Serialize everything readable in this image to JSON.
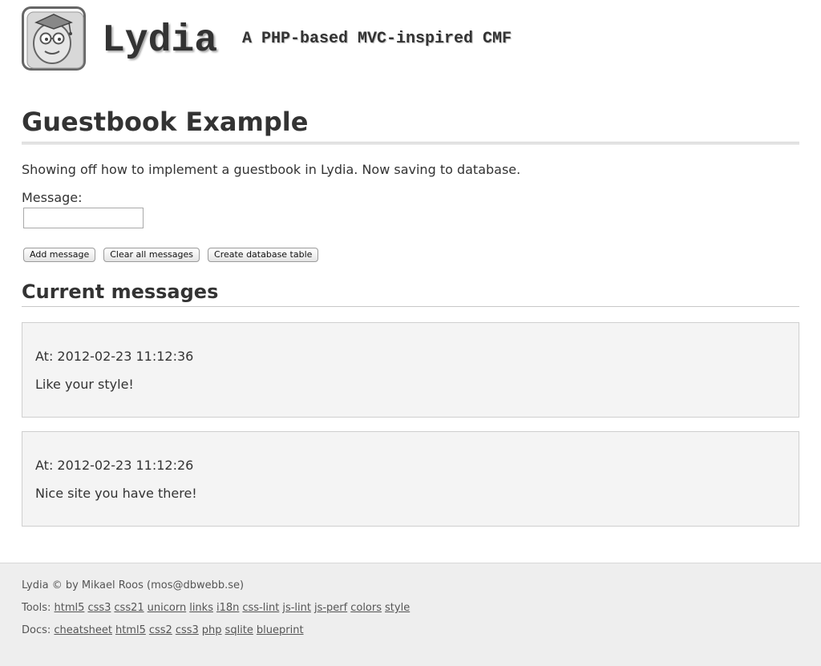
{
  "header": {
    "logo_icon": "lydia-logo-icon",
    "site_title": "Lydia",
    "site_slogan": "A PHP-based MVC-inspired CMF"
  },
  "main": {
    "page_title": "Guestbook Example",
    "intro": "Showing off how to implement a guestbook in Lydia. Now saving to database.",
    "form": {
      "message_label": "Message:",
      "message_value": "",
      "buttons": [
        {
          "label": "Add message"
        },
        {
          "label": "Clear all messages"
        },
        {
          "label": "Create database table"
        }
      ]
    },
    "messages_title": "Current messages",
    "messages": [
      {
        "time": "At: 2012-02-23 11:12:36",
        "text": "Like your style!"
      },
      {
        "time": "At: 2012-02-23 11:12:26",
        "text": "Nice site you have there!"
      }
    ]
  },
  "footer": {
    "copyright": "Lydia © by Mikael Roos (mos@dbwebb.se)",
    "tools_label": "Tools:",
    "tools_links": [
      "html5",
      "css3",
      "css21",
      "unicorn",
      "links",
      "i18n",
      "css-lint",
      "js-lint",
      "js-perf",
      "colors",
      "style"
    ],
    "docs_label": "Docs:",
    "docs_links": [
      "cheatsheet",
      "html5",
      "css2",
      "css3",
      "php",
      "sqlite",
      "blueprint"
    ]
  },
  "colors": {
    "text": "#333333",
    "footer_bg": "#eeeeee",
    "message_bg": "#f4f4f4",
    "message_border": "#cfcfcf"
  }
}
